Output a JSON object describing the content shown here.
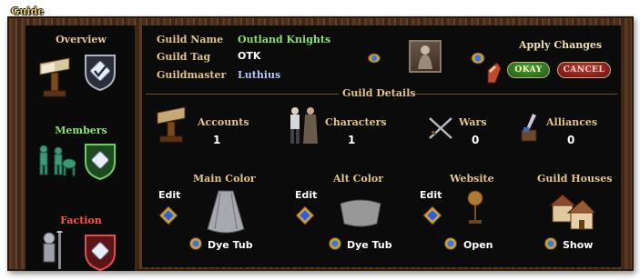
{
  "window": {
    "tab_label": "Guide"
  },
  "sidebar": {
    "sections": [
      {
        "title": "Overview"
      },
      {
        "title": "Members"
      },
      {
        "title": "Faction"
      }
    ]
  },
  "guild_info": {
    "name_label": "Guild Name",
    "name_value": "Outland Knights",
    "tag_label": "Guild Tag",
    "tag_value": "OTK",
    "master_label": "Guildmaster",
    "master_value": "Luthius"
  },
  "apply": {
    "title": "Apply Changes",
    "okay_label": "OKAY",
    "cancel_label": "CANCEL"
  },
  "details": {
    "header": "Guild Details",
    "stats": [
      {
        "label": "Accounts",
        "value": "1"
      },
      {
        "label": "Characters",
        "value": "1"
      },
      {
        "label": "Wars",
        "value": "0"
      },
      {
        "label": "Alliances",
        "value": "0"
      }
    ],
    "main_color": {
      "title": "Main Color",
      "edit": "Edit",
      "action": "Dye Tub"
    },
    "alt_color": {
      "title": "Alt Color",
      "edit": "Edit",
      "action": "Dye Tub"
    },
    "website": {
      "title": "Website",
      "edit": "Edit",
      "action": "Open"
    },
    "houses": {
      "title": "Guild Houses",
      "action": "Show"
    }
  },
  "colors": {
    "frame_wood": "#5a3a22",
    "panel_bg": "#0b0b0b",
    "label_gold": "#e0c48a",
    "guild_name_green": "#8ce070",
    "faction_red": "#ff5040"
  }
}
